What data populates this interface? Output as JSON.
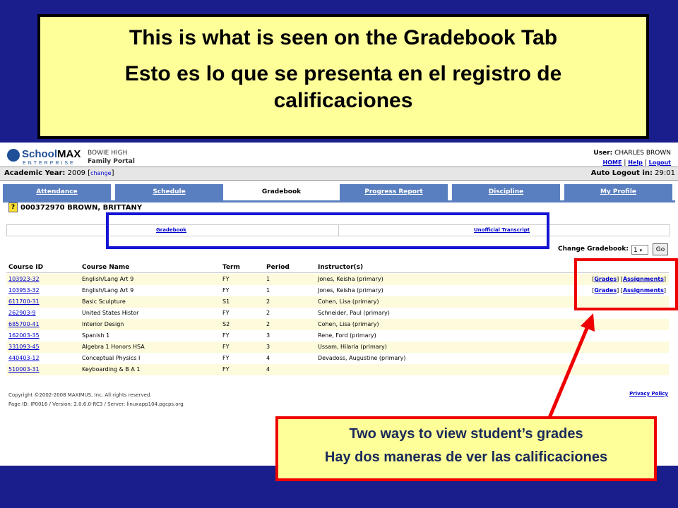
{
  "slide": {
    "title_en": "This is what is seen on the Gradebook Tab",
    "title_es": "Esto es lo que se presenta en el registro de calificaciones",
    "callout_en": "Two ways to view student’s grades",
    "callout_es": "Hay dos maneras de ver las calificaciones"
  },
  "header": {
    "logo_prefix": "School",
    "logo_bold": "MAX",
    "logo_sub": "ENTERPRISE",
    "school_name": "BOWIE HIGH",
    "portal_name": "Family Portal",
    "user_label": "User:",
    "user_name": "CHARLES BROWN",
    "home_link": "HOME",
    "help_link": "Help",
    "logout_link": "Logout",
    "separator": "|"
  },
  "academic": {
    "label": "Academic Year:",
    "year": "2009",
    "change_link": "change",
    "auto_logout_label": "Auto Logout in:",
    "auto_logout_time": "29:01"
  },
  "tabs": [
    "Attendance",
    "Schedule",
    "Gradebook",
    "Progress Report",
    "Discipline",
    "My Profile"
  ],
  "student": {
    "help_icon": "?",
    "id_name": "000372970 BROWN, BRITTANY"
  },
  "subtabs": {
    "gradebook": "Gradebook",
    "transcript": "Unofficial Transcript"
  },
  "change_gradebook": {
    "label": "Change Gradebook:",
    "selected": "1",
    "go": "Go"
  },
  "table": {
    "headers": [
      "Course ID",
      "Course Name",
      "Term",
      "Period",
      "Instructor(s)"
    ],
    "rows": [
      {
        "id": "103923-32",
        "name": "English/Lang Art 9",
        "term": "FY",
        "period": "1",
        "instructor": "Jones, Keisha (primary)",
        "grades": "Grades",
        "assignments": "Assignments"
      },
      {
        "id": "103953-32",
        "name": "English/Lang Art 9",
        "term": "FY",
        "period": "1",
        "instructor": "Jones, Keisha (primary)",
        "grades": "Grades",
        "assignments": "Assignments"
      },
      {
        "id": "611700-31",
        "name": "Basic Sculpture",
        "term": "S1",
        "period": "2",
        "instructor": "Cohen, Lisa (primary)"
      },
      {
        "id": "262903-9",
        "name": "United States Histor",
        "term": "FY",
        "period": "2",
        "instructor": "Schneider, Paul (primary)"
      },
      {
        "id": "685700-41",
        "name": "Interior Design",
        "term": "S2",
        "period": "2",
        "instructor": "Cohen, Lisa (primary)"
      },
      {
        "id": "162003-35",
        "name": "Spanish 1",
        "term": "FY",
        "period": "3",
        "instructor": "Rene, Ford (primary)"
      },
      {
        "id": "331093-45",
        "name": "Algebra 1 Honors HSA",
        "term": "FY",
        "period": "3",
        "instructor": "Ussam, Hilaria (primary)"
      },
      {
        "id": "440403-12",
        "name": "Conceptual Physics I",
        "term": "FY",
        "period": "4",
        "instructor": "Devadoss, Augustine (primary)"
      },
      {
        "id": "510003-31",
        "name": "Keyboarding & B A 1",
        "term": "FY",
        "period": "4",
        "instructor": ""
      }
    ]
  },
  "footer": {
    "copyright": "Copyright ©2002-2008 MAXIMUS, Inc. All rights reserved.",
    "page_id": "Page ID: IP0016 / Version: 2.0.6.0-RC3 / Server: linuxapp104.pgcps.org",
    "privacy": "Privacy Policy"
  },
  "colors": {
    "background": "#1a1e8c",
    "slide_box": "#ffff99",
    "tab": "#5a7fc0",
    "highlight_blue": "#1414d4",
    "highlight_red": "#e00000"
  }
}
